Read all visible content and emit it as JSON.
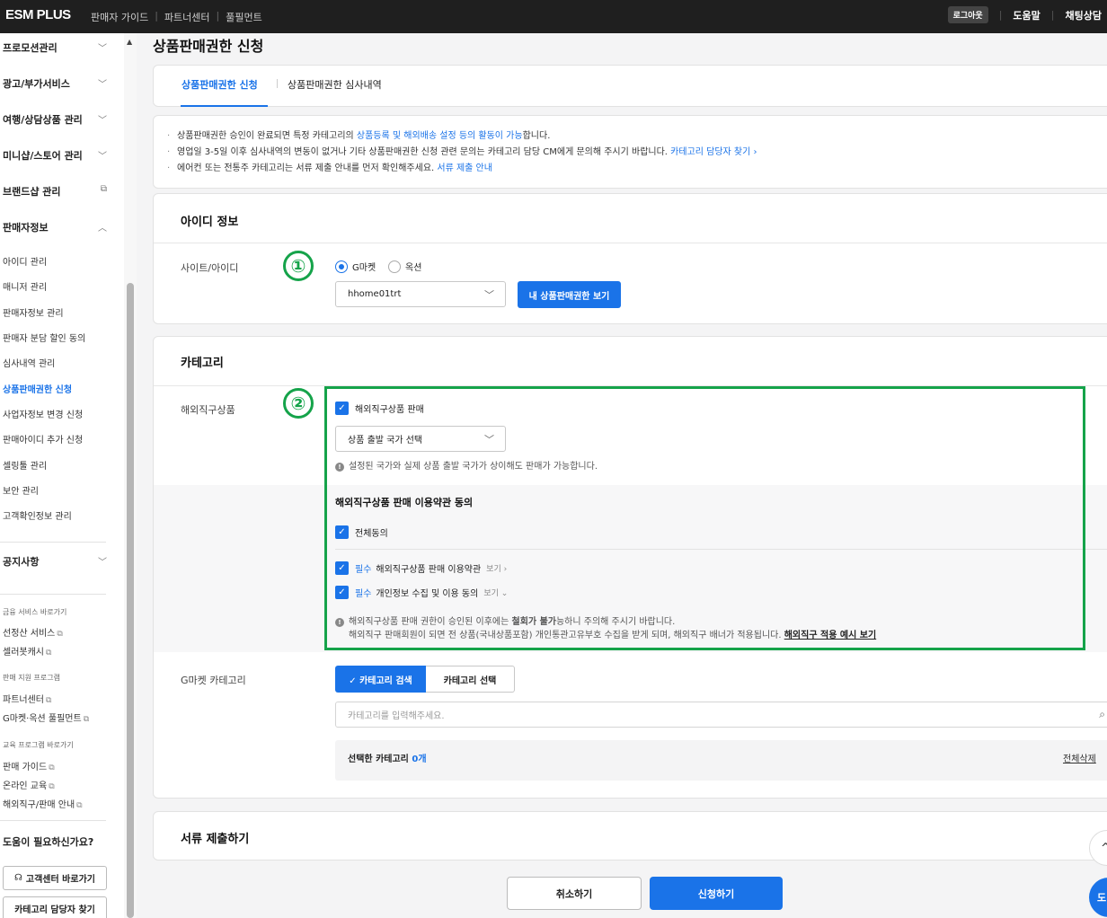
{
  "topbar": {
    "logo": "ESM PLUS",
    "nav": [
      "판매자 가이드",
      "파트너센터",
      "풀필먼트"
    ],
    "logout": "로그아웃",
    "help": "도움말",
    "chat": "채팅상담"
  },
  "sidebar": {
    "menus": [
      "프로모션관리",
      "광고/부가서비스",
      "여행/상담상품 관리",
      "미니샵/스토어 관리",
      "브랜드샵 관리",
      "판매자정보"
    ],
    "seller_items": [
      "아이디 관리",
      "매니저 관리",
      "판매자정보 관리",
      "판매자 분담 할인 동의",
      "심사내역 관리",
      "상품판매권한 신청",
      "사업자정보 변경 신청",
      "판매아이디 추가 신청",
      "셀링툴 관리",
      "보안 관리",
      "고객확인정보 관리"
    ],
    "notice": "공지사항",
    "finance_title": "금융 서비스 바로가기",
    "finance_links": [
      "선정산 서비스",
      "셀러봇캐시"
    ],
    "support_title": "판매 지원 프로그램",
    "support_links": [
      "파트너센터",
      "G마켓·옥션 풀필먼트"
    ],
    "edu_title": "교육 프로그램 바로가기",
    "edu_links": [
      "판매 가이드",
      "온라인 교육",
      "해외직구/판매 안내"
    ],
    "help_title": "도움이 필요하신가요?",
    "cs_button": "고객센터 바로가기",
    "cm_button": "카테고리 담당자 찾기"
  },
  "page": {
    "title": "상품판매권한 신청",
    "tabs": [
      "상품판매권한 신청",
      "상품판매권한 심사내역"
    ]
  },
  "notice": {
    "line1_a": "상품판매권한 승인이 완료되면 특정 카테고리의 ",
    "line1_link": "상품등록 및 해외배송 설정 등의 활동이 가능",
    "line1_b": "합니다.",
    "line2_a": "영업일 3-5일 이후 심사내역의 변동이 없거나 기타 상품판매권한 신청 관련 문의는 카테고리 담당 CM에게 문의해 주시기 바랍니다.  ",
    "line2_link": "카테고리 담당자 찾기 ›",
    "line3_a": "에어컨 또는 전통주 카테고리는 서류 제출 안내를 먼저 확인해주세요.  ",
    "line3_link": "서류 제출 안내"
  },
  "id_section": {
    "title": "아이디 정보",
    "label": "사이트/아이디",
    "marker": "①",
    "radio_gmarket": "G마켓",
    "radio_auction": "옥션",
    "selected_id": "hhome01trt",
    "view_button": "내 상품판매권한 보기"
  },
  "category_section": {
    "title": "카테고리",
    "overseas_label": "해외직구상품",
    "marker": "②",
    "overseas_check": "해외직구상품 판매",
    "country_select": "상품 출발 국가 선택",
    "country_info": "설정된 국가와 실제 상품 출발 국가가 상이해도 판매가 가능합니다.",
    "terms_title": "해외직구상품 판매 이용약관 동의",
    "agree_all": "전체동의",
    "required": "필수",
    "term1": "해외직구상품 판매 이용약관",
    "term1_view": "보기 ›",
    "term2": "개인정보 수집 및 이용 동의",
    "term2_view": "보기 ⌄",
    "warn1_a": "해외직구상품 판매 권한이 승인된 이후에는 ",
    "warn1_bold": "철회가 불가",
    "warn1_b": "능하니 주의해 주시기 바랍니다.",
    "warn2_a": "해외직구 판매회원이 되면 전 상품(국내상품포함) 개인통관고유부호 수집을 받게 되며, 해외직구 배너가 적용됩니다. ",
    "warn2_link": "해외직구 적용 예시 보기",
    "gmarket_label": "G마켓 카테고리",
    "seg_search": "✓ 카테고리 검색",
    "seg_select": "카테고리 선택",
    "search_placeholder": "카테고리를 입력해주세요.",
    "selected_label": "선택한 카테고리 ",
    "selected_count": "0개",
    "delete_all": "전체삭제"
  },
  "docs_section": {
    "title": "서류 제출하기"
  },
  "actions": {
    "cancel": "취소하기",
    "submit": "신청하기"
  },
  "floating": {
    "up": "^",
    "help": "도"
  },
  "colors": {
    "accent": "#1a73e8",
    "highlight": "#15a34a",
    "topbar": "#1f1f1f"
  }
}
